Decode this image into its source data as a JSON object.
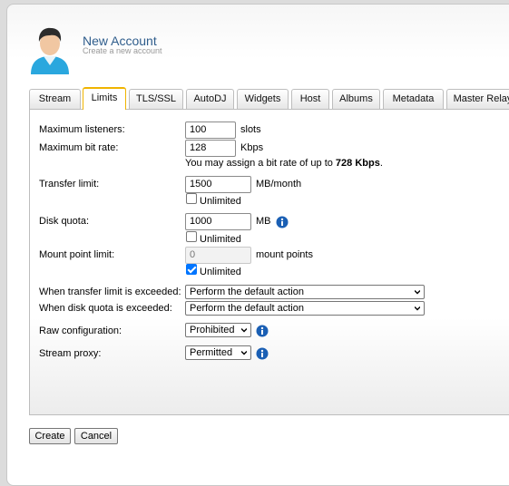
{
  "header": {
    "title": "New Account",
    "subtitle": "Create a new account"
  },
  "tabs": [
    {
      "label": "Stream"
    },
    {
      "label": "Limits"
    },
    {
      "label": "TLS/SSL"
    },
    {
      "label": "AutoDJ"
    },
    {
      "label": "Widgets"
    },
    {
      "label": "Host"
    },
    {
      "label": "Albums"
    },
    {
      "label": "Metadata"
    },
    {
      "label": "Master Relay"
    }
  ],
  "active_tab": "Limits",
  "form": {
    "max_listeners": {
      "label": "Maximum listeners:",
      "value": "100",
      "unit": "slots"
    },
    "max_bitrate": {
      "label": "Maximum bit rate:",
      "value": "128",
      "unit": "Kbps",
      "note_prefix": "You may assign a bit rate of up to ",
      "note_value": "728 Kbps",
      "note_suffix": "."
    },
    "transfer_limit": {
      "label": "Transfer limit:",
      "value": "1500",
      "unit": "MB/month",
      "unlimited_label": "Unlimited",
      "unlimited": false
    },
    "disk_quota": {
      "label": "Disk quota:",
      "value": "1000",
      "unit": "MB",
      "unlimited_label": "Unlimited",
      "unlimited": false
    },
    "mount_point_limit": {
      "label": "Mount point limit:",
      "placeholder": "0",
      "unit": "mount points",
      "unlimited_label": "Unlimited",
      "unlimited": true
    },
    "transfer_exceeded": {
      "label": "When transfer limit is exceeded:",
      "value": "Perform the default action"
    },
    "disk_exceeded": {
      "label": "When disk quota is exceeded:",
      "value": "Perform the default action"
    },
    "raw_config": {
      "label": "Raw configuration:",
      "value": "Prohibited"
    },
    "stream_proxy": {
      "label": "Stream proxy:",
      "value": "Permitted"
    }
  },
  "buttons": {
    "create": "Create",
    "cancel": "Cancel"
  },
  "colors": {
    "title": "#2f5d8c",
    "active_tab_border": "#f0b400",
    "info_icon": "#1a5fb4",
    "checkbox": "#0075ff"
  }
}
